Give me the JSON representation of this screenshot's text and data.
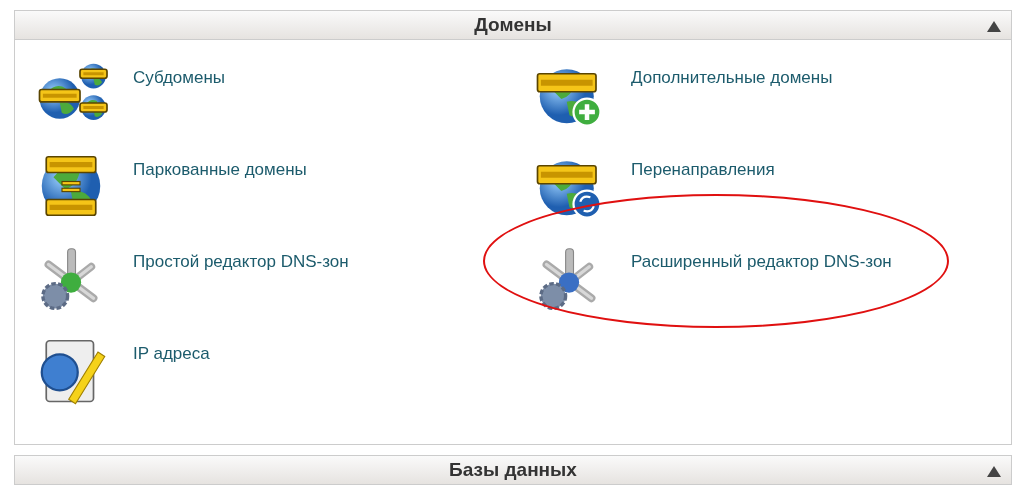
{
  "panels": [
    {
      "title": "Домены",
      "expanded": true,
      "items": [
        {
          "kind": "subdomains",
          "label": "Субдомены",
          "highlighted": false
        },
        {
          "kind": "addon",
          "label": "Дополнительные домены",
          "highlighted": false
        },
        {
          "kind": "parked",
          "label": "Паркованные домены",
          "highlighted": false
        },
        {
          "kind": "redirects",
          "label": "Перенаправления",
          "highlighted": false
        },
        {
          "kind": "dns-simple",
          "label": "Простой редактор DNS-зон",
          "highlighted": false
        },
        {
          "kind": "dns-advanced",
          "label": "Расширенный редактор DNS-зон",
          "highlighted": true
        },
        {
          "kind": "ip",
          "label": "IP адреса",
          "highlighted": false
        }
      ]
    },
    {
      "title": "Базы данных",
      "expanded": true
    }
  ]
}
